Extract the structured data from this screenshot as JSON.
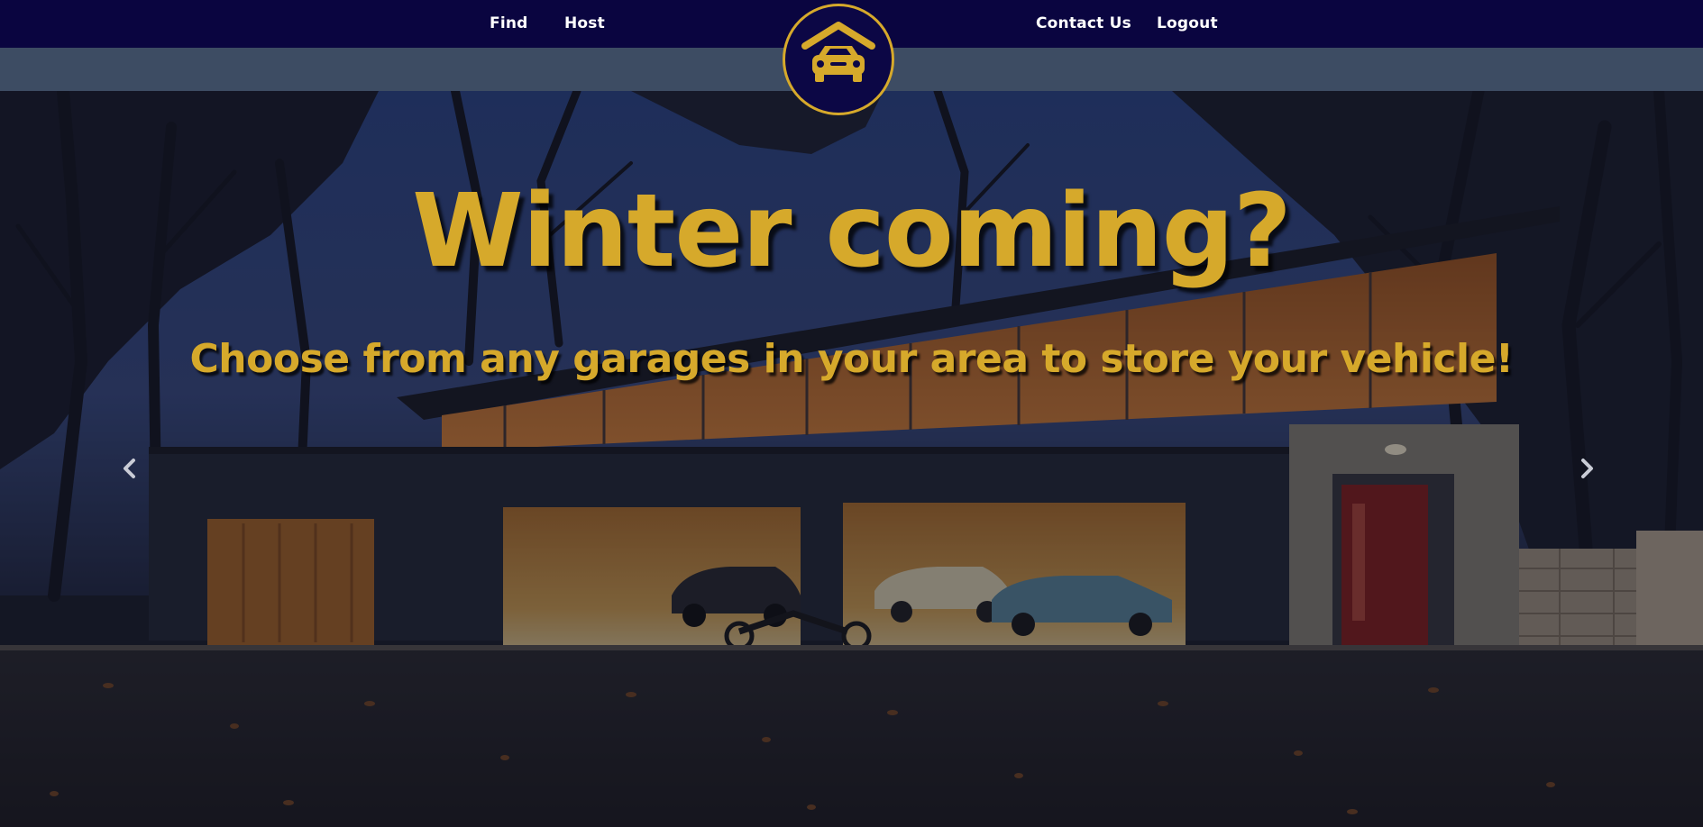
{
  "nav": {
    "left_links": [
      {
        "label": "Find"
      },
      {
        "label": "Host"
      }
    ],
    "right_links": [
      {
        "label": "Contact Us"
      },
      {
        "label": "Logout"
      }
    ],
    "background": "#0a0540",
    "subbar_color": "#3d4c63"
  },
  "logo": {
    "icon": "garage-car-icon",
    "accent": "#d6a92b"
  },
  "hero": {
    "headline": "Winter coming?",
    "subheadline": "Choose from any garages in your area to store your vehicle!",
    "text_color": "#d6a92b",
    "background_image": "garage-at-dusk-photo",
    "prev_icon": "chevron-left-icon",
    "next_icon": "chevron-right-icon"
  }
}
